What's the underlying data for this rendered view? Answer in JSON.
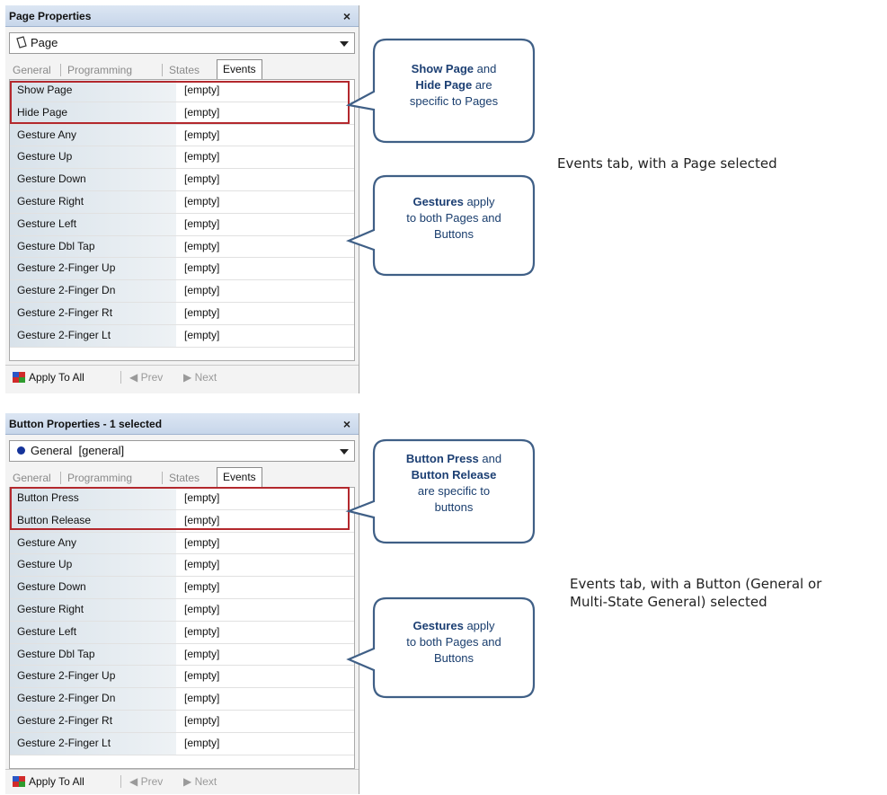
{
  "panels": [
    {
      "title": "Page Properties",
      "close_label": "×",
      "dropdown_value": "Page",
      "dropdown_icon": "page-icon",
      "tabs": [
        "General",
        "Programming",
        "States",
        "Events"
      ],
      "active_tab": "Events",
      "rows": [
        {
          "name": "Show Page",
          "value": "[empty]"
        },
        {
          "name": "Hide Page",
          "value": "[empty]"
        },
        {
          "name": "Gesture Any",
          "value": "[empty]"
        },
        {
          "name": "Gesture Up",
          "value": "[empty]"
        },
        {
          "name": "Gesture Down",
          "value": "[empty]"
        },
        {
          "name": "Gesture Right",
          "value": "[empty]"
        },
        {
          "name": "Gesture Left",
          "value": "[empty]"
        },
        {
          "name": "Gesture Dbl Tap",
          "value": "[empty]"
        },
        {
          "name": "Gesture 2-Finger Up",
          "value": "[empty]"
        },
        {
          "name": "Gesture 2-Finger Dn",
          "value": "[empty]"
        },
        {
          "name": "Gesture 2-Finger Rt",
          "value": "[empty]"
        },
        {
          "name": "Gesture 2-Finger Lt",
          "value": "[empty]"
        }
      ],
      "footer": {
        "apply": "Apply To All",
        "prev": "Prev",
        "next": "Next"
      }
    },
    {
      "title": "Button Properties - 1 selected",
      "close_label": "×",
      "dropdown_value": "General  [general]",
      "dropdown_icon": "bullet-icon",
      "tabs": [
        "General",
        "Programming",
        "States",
        "Events"
      ],
      "active_tab": "Events",
      "rows": [
        {
          "name": "Button Press",
          "value": "[empty]"
        },
        {
          "name": "Button Release",
          "value": "[empty]"
        },
        {
          "name": "Gesture Any",
          "value": "[empty]"
        },
        {
          "name": "Gesture Up",
          "value": "[empty]"
        },
        {
          "name": "Gesture Down",
          "value": "[empty]"
        },
        {
          "name": "Gesture Right",
          "value": "[empty]"
        },
        {
          "name": "Gesture Left",
          "value": "[empty]"
        },
        {
          "name": "Gesture Dbl Tap",
          "value": "[empty]"
        },
        {
          "name": "Gesture 2-Finger Up",
          "value": "[empty]"
        },
        {
          "name": "Gesture 2-Finger Dn",
          "value": "[empty]"
        },
        {
          "name": "Gesture 2-Finger Rt",
          "value": "[empty]"
        },
        {
          "name": "Gesture 2-Finger Lt",
          "value": "[empty]"
        }
      ],
      "footer": {
        "apply": "Apply To All",
        "prev": "Prev",
        "next": "Next"
      }
    }
  ],
  "callouts": {
    "page_specific": {
      "line1_bold": "Show Page",
      "line1_rest": " and",
      "line2_bold": "Hide Page",
      "line2_rest": " are",
      "line3": "specific to Pages"
    },
    "page_gestures": {
      "line1_bold": "Gestures",
      "line1_rest": " apply",
      "line2": "to both Pages and",
      "line3": "Buttons"
    },
    "button_specific": {
      "line1_bold": "Button Press",
      "line1_rest": " and",
      "line2_bold": "Button Release",
      "line3": "are specific to",
      "line4": "buttons"
    },
    "button_gestures": {
      "line1_bold": "Gestures",
      "line1_rest": " apply",
      "line2": "to both Pages and",
      "line3": "Buttons"
    }
  },
  "captions": {
    "page": "Events tab, with a Page selected",
    "button_line1": "Events tab, with a Button (General or",
    "button_line2": "Multi-State General) selected"
  },
  "colors": {
    "highlight_border": "#b3282d",
    "callout_border": "#3f5f86",
    "callout_text": "#1a3e6e",
    "title_bar": "#c7d6ea"
  }
}
